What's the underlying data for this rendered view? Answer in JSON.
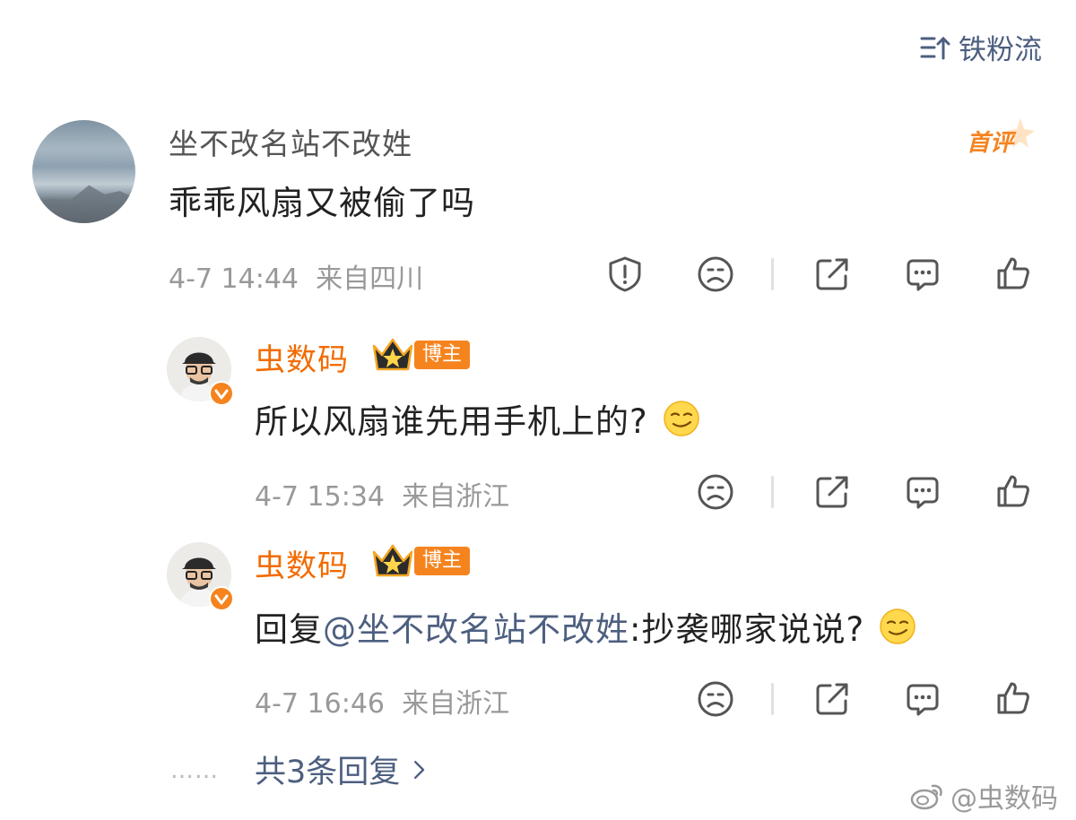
{
  "header": {
    "sort_label": "铁粉流",
    "sort_icon": "sort-lines-icon"
  },
  "comment": {
    "username": "坐不改名站不改姓",
    "text": "乖乖风扇又被偷了吗",
    "badge": "首评",
    "time": "4-7 14:44",
    "location": "来自四川",
    "actions": [
      "report-icon",
      "dislike-face-icon",
      "share-icon",
      "comment-icon",
      "like-icon"
    ]
  },
  "replies": [
    {
      "username": "虫数码",
      "role_tag": "博主",
      "text": "所以风扇谁先用手机上的?",
      "emoji": "smirk-emoji",
      "time": "4-7 15:34",
      "location": "来自浙江"
    },
    {
      "username": "虫数码",
      "role_tag": "博主",
      "prefix": "回复",
      "mention": "@坐不改名站不改姓",
      "text": ":抄袭哪家说说?",
      "emoji": "smirk-emoji",
      "time": "4-7 16:46",
      "location": "来自浙江"
    }
  ],
  "footer": {
    "dots": "……",
    "more_replies": "共3条回复",
    "watermark": "@虫数码"
  },
  "colors": {
    "brand_orange": "#f26b00",
    "link_blue": "#4d5f80",
    "meta_gray": "#999999"
  }
}
